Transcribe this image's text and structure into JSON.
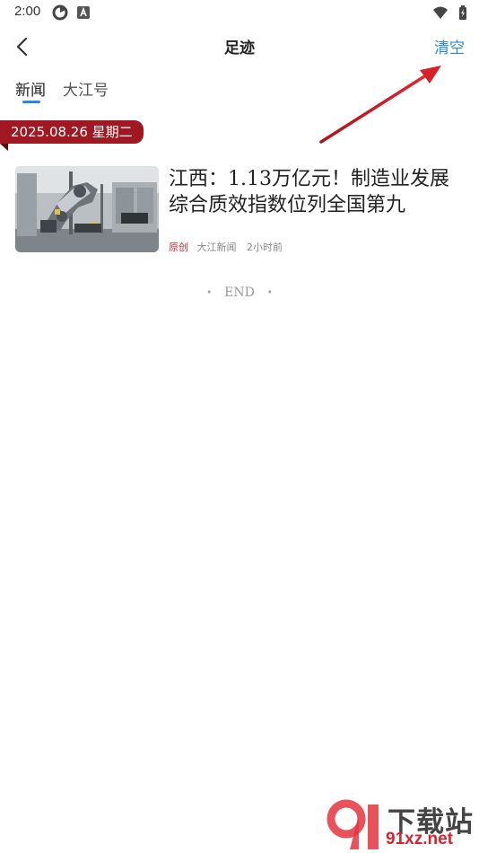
{
  "status_bar": {
    "time": "2:00"
  },
  "header": {
    "title": "足迹",
    "clear_label": "清空"
  },
  "tabs": [
    {
      "label": "新闻",
      "active": true
    },
    {
      "label": "大江号",
      "active": false
    }
  ],
  "date_group": {
    "label": "2025.08.26 星期二"
  },
  "news_items": [
    {
      "title": "江西：1.13万亿元！制造业发展综合质效指数位列全国第九",
      "tag": "原创",
      "source": "大江新闻",
      "time": "2小时前"
    }
  ],
  "end_text": "END",
  "watermark": {
    "text_top": "下载站",
    "text_bottom": "91xz.net"
  },
  "colors": {
    "accent": "#2a88d6",
    "ribbon": "#a01822",
    "tag": "#c0303a",
    "arrow": "#d42027"
  }
}
